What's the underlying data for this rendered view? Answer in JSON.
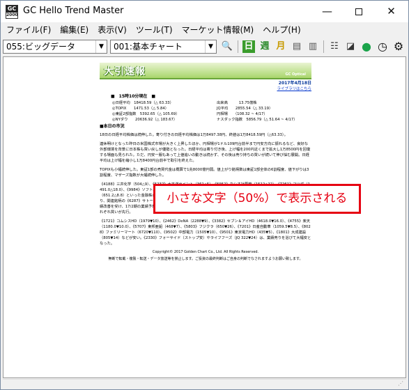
{
  "window": {
    "title": "GC Hello Trend Master",
    "icon_text_top": "GC",
    "icon_text_bottom": "2000",
    "buttons": [
      "minimize-icon",
      "maximize-icon",
      "close-icon"
    ]
  },
  "menu": {
    "items": [
      "ファイル(F)",
      "編集(E)",
      "表示(V)",
      "ツール(T)",
      "マーケット情報(M)",
      "ヘルプ(H)"
    ]
  },
  "toolbar": {
    "combo1": "055:ビッグデータ",
    "combo2": "001:基本チャート",
    "dropdown_arrow": "▼",
    "icons": {
      "search": "🔍",
      "day": "日",
      "week": "週",
      "month": "月",
      "list1": "▤",
      "list2": "▥",
      "grid": "☷",
      "chart": "◪",
      "globe": "●",
      "clock": "◷",
      "gear": "⚙"
    }
  },
  "report": {
    "banner_title": "大引速報",
    "banner_sub": "GC Optical",
    "date": "2017年4月18日",
    "library_link": "ライブラリはこちら",
    "time_line": "■　15時10分現在　■",
    "quotes": [
      {
        "left": "◎日経平均　18418.59（△ 63.33）",
        "right": "出来高　　　13.75億株"
      },
      {
        "left": "◎TOPIX　　1471.53（△ 5.84）",
        "right": "JQ平均　　2855.54（△ 33.19）"
      },
      {
        "left": "◎東証2部指数　5392.65（△ 105.69）",
        "right": "円相場　　（108.32 ~ 4/17）"
      },
      {
        "left": "◎NYダウ　　20636.92（△ 183.67）",
        "right": "ナスダック指数　5856.79（△ 51.64 ~ 4/17）"
      }
    ],
    "section_title": "■本日の市況",
    "paragraphs": [
      "18日の日経平均株価は続伸した。寄り付きの日経平均株価は1万8497.38円、終値は1万8418.59円（△63.33）。",
      "連休明けとなった昨日の米国株式市場が大きく上昇したほか、円相場が1ドル109円台前半まで円安方向に振れるなど、良好な外部環境を背景に日本株も買い戻しが優勢となった。日経平均は寄り付き後、上げ幅を200円近くまで拡大し1万8500円を回復する場面も見られた。ただ、円安一服もあって上値追いの動きは続かず、その後は売り持ちの買いが続いて伸び悩む展開。日経平均は上げ幅を縮小し1万8400円台前半で取引を終えた。",
      "TOPIXも小幅続伸した。東証1部の売買代金は概算で1兆8000億円弱。値上がり銘柄数は東証1部全体の6割程度、値下がりは3割程度、マザーズ指数が大幅続伸した。",
      "《4188》三井化学（504△9）、《5232》太平洋セメント（361△5）、《6952》カシオ計算機（1512△22）、《7261》マツダ（1491.0△18.0）、《9984》ソフトバンクG（7718△122）などが高い。《8411》みずほFG（191.1△2.1）や《8604》野村HD（651.2△8.8）といった金融株の一角もしっかり。大手コンビニ5社が2025年までに無人レジを国内全店舗へ導入すると伝わり、関連銘柄の《6287》サトーHD（2877△116）に思惑買いが膨らんだ。《4004》昭和電工（1760△45）は、16/12期の業績改善を受け、17/2期の業績予想を上方修正し、《6440》JUKI（1394△205）や《4099》四国化成工業（1189△42）は、それぞれ買いが先行。",
      "《1721》コムシスHD（1979▼10）、《2462》DeNA（2288▼9）、《3382》セブン＆アイHD（4618.0▼16.0）、《4755》楽天（1180.0▼10.0）、《5707》東邦亜鉛（468▼7）、《5803》フジクラ（650▼26）、《7201》日産自動車（1059.5▼8.5）、《8028》ファミリーマート（6720▼110）、《9502》中部電力（1505▼10）、《9501》東京電力HD（435▼5）、《1801》大成建設（805▼14）などが安い。《2330》フォーサイド（ストップ安）やライフフーズ（JQ 322▼24）は、業績売りを浴びて大幅安となった。"
    ],
    "copyright": "Copyright© 2017 Golden Chart Co., Ltd. All Rights Reserved.",
    "disclaimer": "無断で転載・複製・転送・データ放送等を禁止します。ご投資の最終判断はご自身の判断でなされますようお願い致します。"
  },
  "callout": {
    "text": "小さな文字（50%）で表示される"
  }
}
